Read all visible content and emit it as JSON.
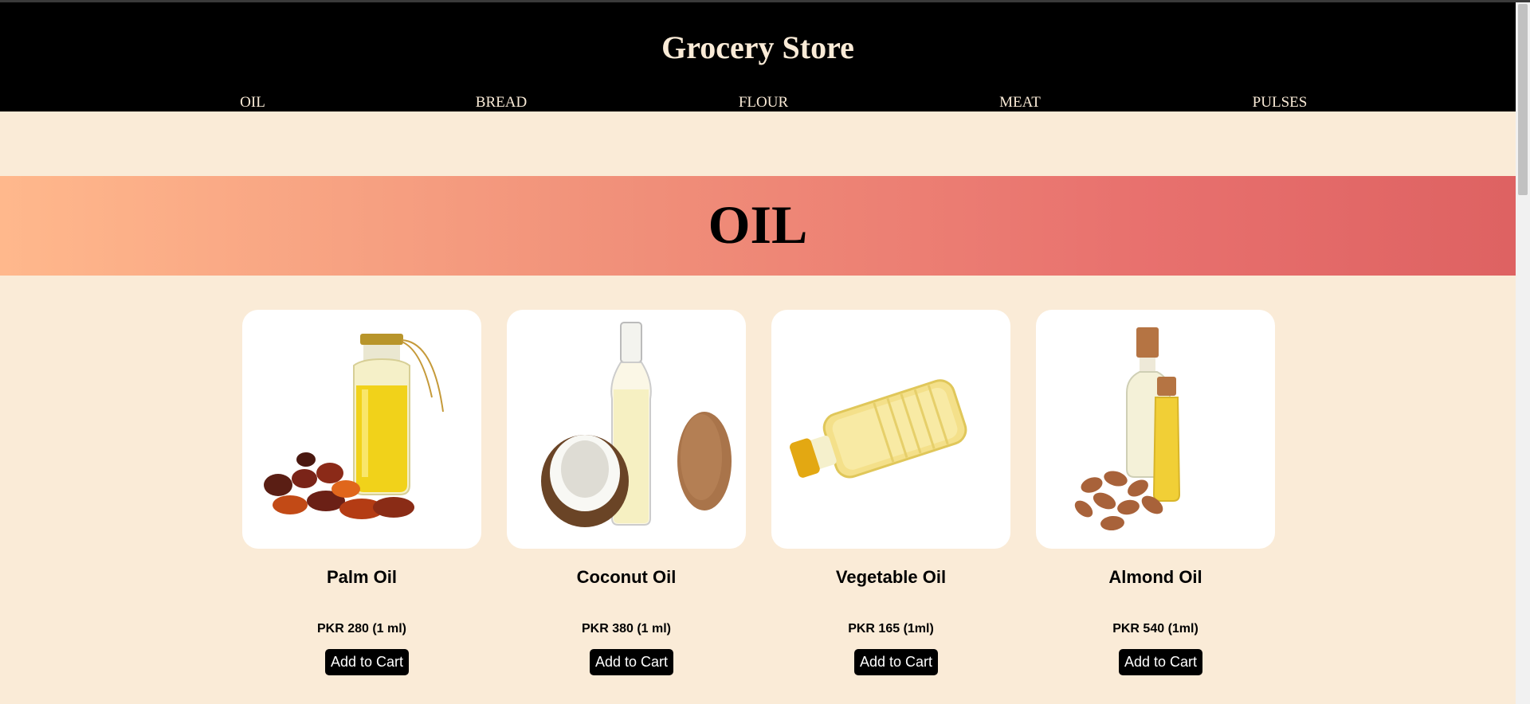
{
  "site": {
    "title": "Grocery Store"
  },
  "nav": {
    "items": [
      {
        "label": "OIL"
      },
      {
        "label": "BREAD"
      },
      {
        "label": "FLOUR"
      },
      {
        "label": "MEAT"
      },
      {
        "label": "PULSES"
      }
    ]
  },
  "banner": {
    "title": "OIL"
  },
  "products": [
    {
      "name": "Palm Oil",
      "price": "PKR 280 (1 ml)",
      "button": "Add to Cart",
      "icon": "palm-oil-image"
    },
    {
      "name": "Coconut Oil",
      "price": "PKR 380 (1 ml)",
      "button": "Add to Cart",
      "icon": "coconut-oil-image"
    },
    {
      "name": "Vegetable Oil",
      "price": "PKR 165 (1ml)",
      "button": "Add to Cart",
      "icon": "vegetable-oil-image"
    },
    {
      "name": "Almond Oil",
      "price": "PKR 540 (1ml)",
      "button": "Add to Cart",
      "icon": "almond-oil-image"
    }
  ],
  "colors": {
    "page_bg": "#faebd7",
    "header_bg": "#000000",
    "header_text": "#faebd7",
    "banner_gradient_start": "#ffb88c",
    "banner_gradient_end": "#de6262",
    "button_bg": "#000000",
    "button_text": "#ffffff"
  }
}
